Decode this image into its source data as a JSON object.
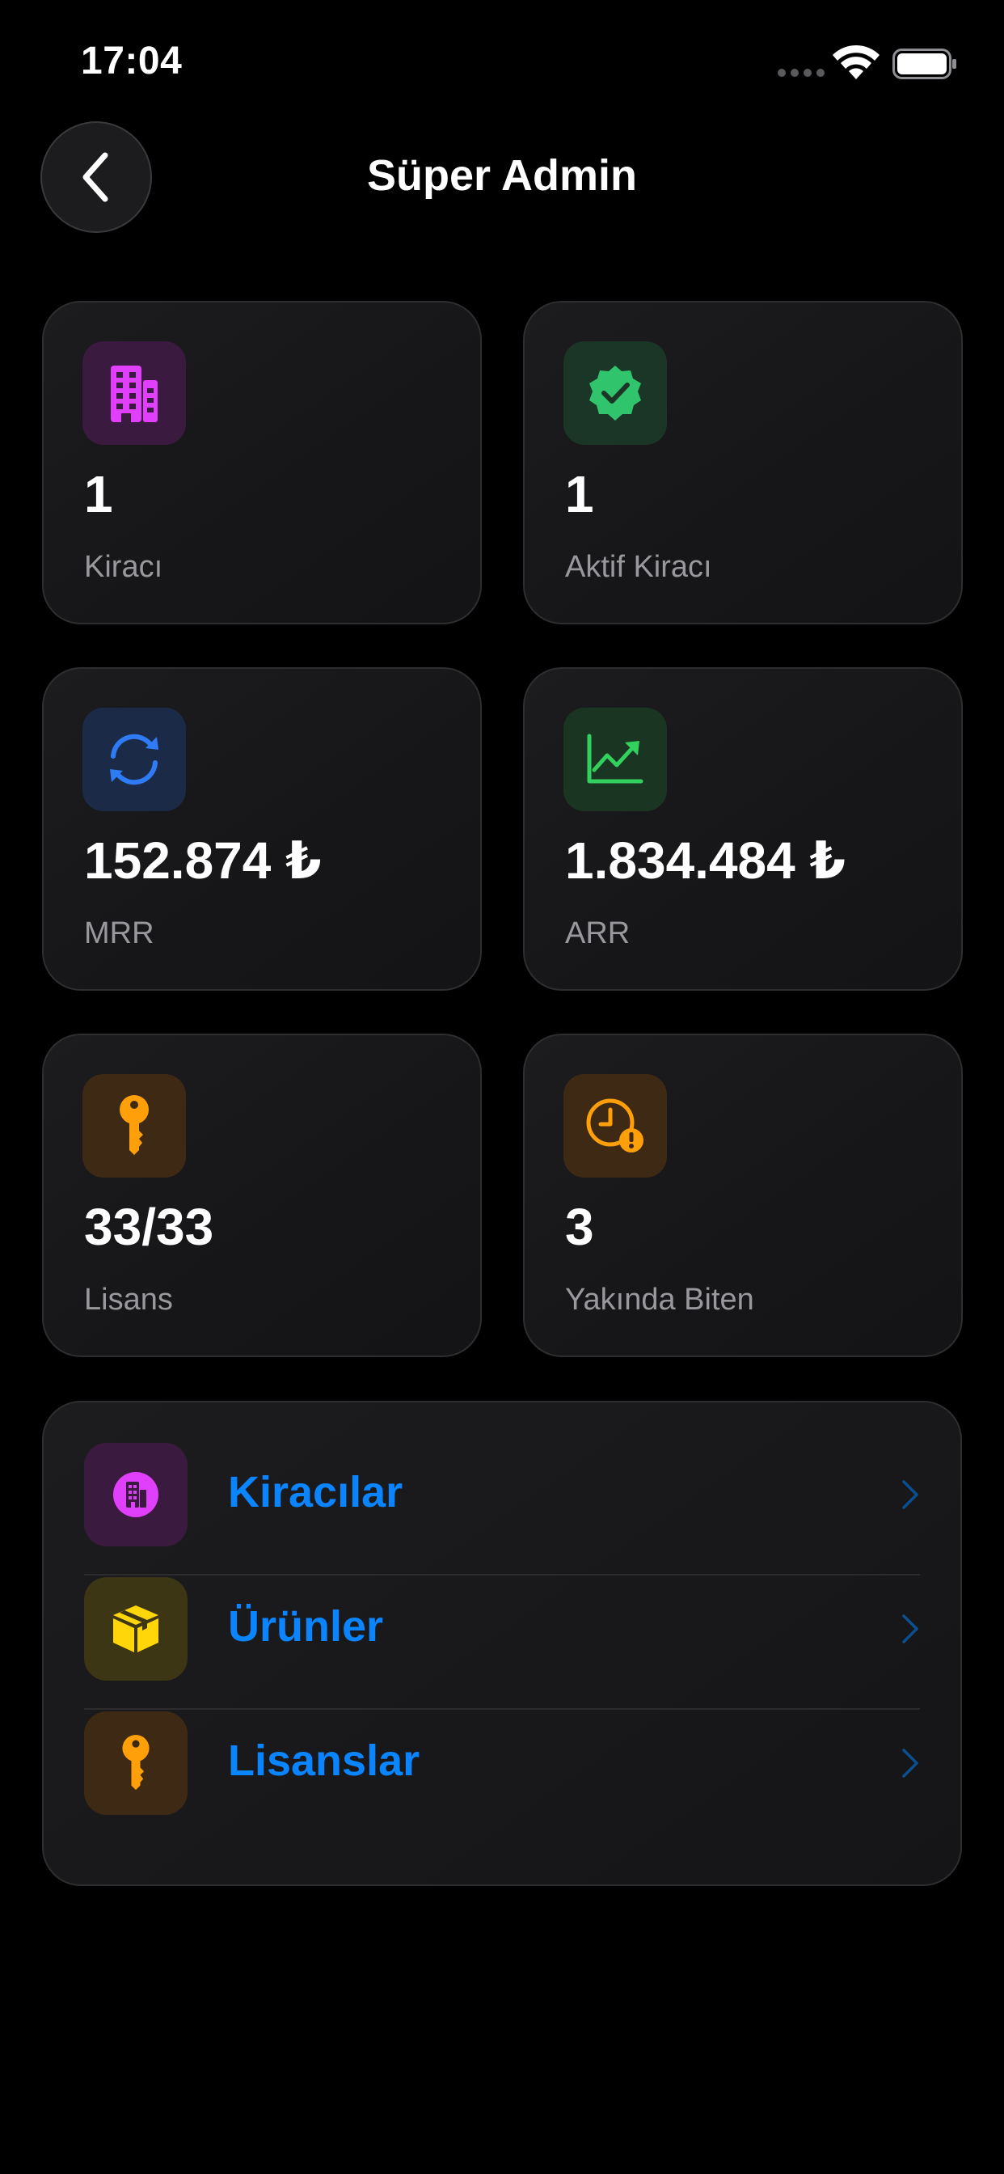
{
  "status_bar": {
    "time": "17:04",
    "icons": [
      "cellular-signal-icon",
      "wifi-icon",
      "battery-icon"
    ]
  },
  "header": {
    "title": "Süper Admin",
    "back_icon": "chevron-left-icon"
  },
  "stats": [
    {
      "value": "1",
      "label": "Kiracı",
      "icon": "building-icon",
      "color": "#e040fb",
      "bg": "#3a1a3e"
    },
    {
      "value": "1",
      "label": "Aktif Kiracı",
      "icon": "verified-badge-icon",
      "color": "#30c46c",
      "bg": "#1b3526"
    },
    {
      "value": "152.874 ₺",
      "label": "MRR",
      "icon": "refresh-arrows-icon",
      "color": "#2f7bf5",
      "bg": "#1a2a47"
    },
    {
      "value": "1.834.484 ₺",
      "label": "ARR",
      "icon": "trending-chart-icon",
      "color": "#32d15d",
      "bg": "#1b3523"
    },
    {
      "value": "33/33",
      "label": "Lisans",
      "icon": "key-icon",
      "color": "#ff9f0a",
      "bg": "#3e2a14"
    },
    {
      "value": "3",
      "label": "Yakında Biten",
      "icon": "clock-warning-icon",
      "color": "#ff9f0a",
      "bg": "#3e2a14"
    }
  ],
  "menu": [
    {
      "label": "Kiracılar",
      "icon": "building-circle-icon",
      "color": "#e040fb",
      "bg": "#3a1a3e"
    },
    {
      "label": "Ürünler",
      "icon": "box-icon",
      "color": "#ffd60a",
      "bg": "#3d3614"
    },
    {
      "label": "Lisanslar",
      "icon": "key-icon",
      "color": "#ff9f0a",
      "bg": "#3e2a14"
    }
  ],
  "colors": {
    "background": "#000000",
    "card": "#1c1c1e",
    "accent": "#0a84ff",
    "secondary_text": "#98989d"
  }
}
